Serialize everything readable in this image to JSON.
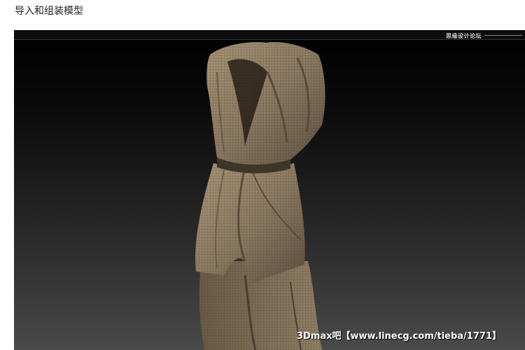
{
  "heading": "导入和组装模型",
  "figure": {
    "top_site_mark": "思缘设计论坛",
    "watermark": "3Dmax吧【www.linecg.com/tieba/1771】",
    "colors": {
      "background_top": "#000000",
      "background_bottom": "#4a4a4a",
      "cloth": "#8c7a62"
    }
  }
}
